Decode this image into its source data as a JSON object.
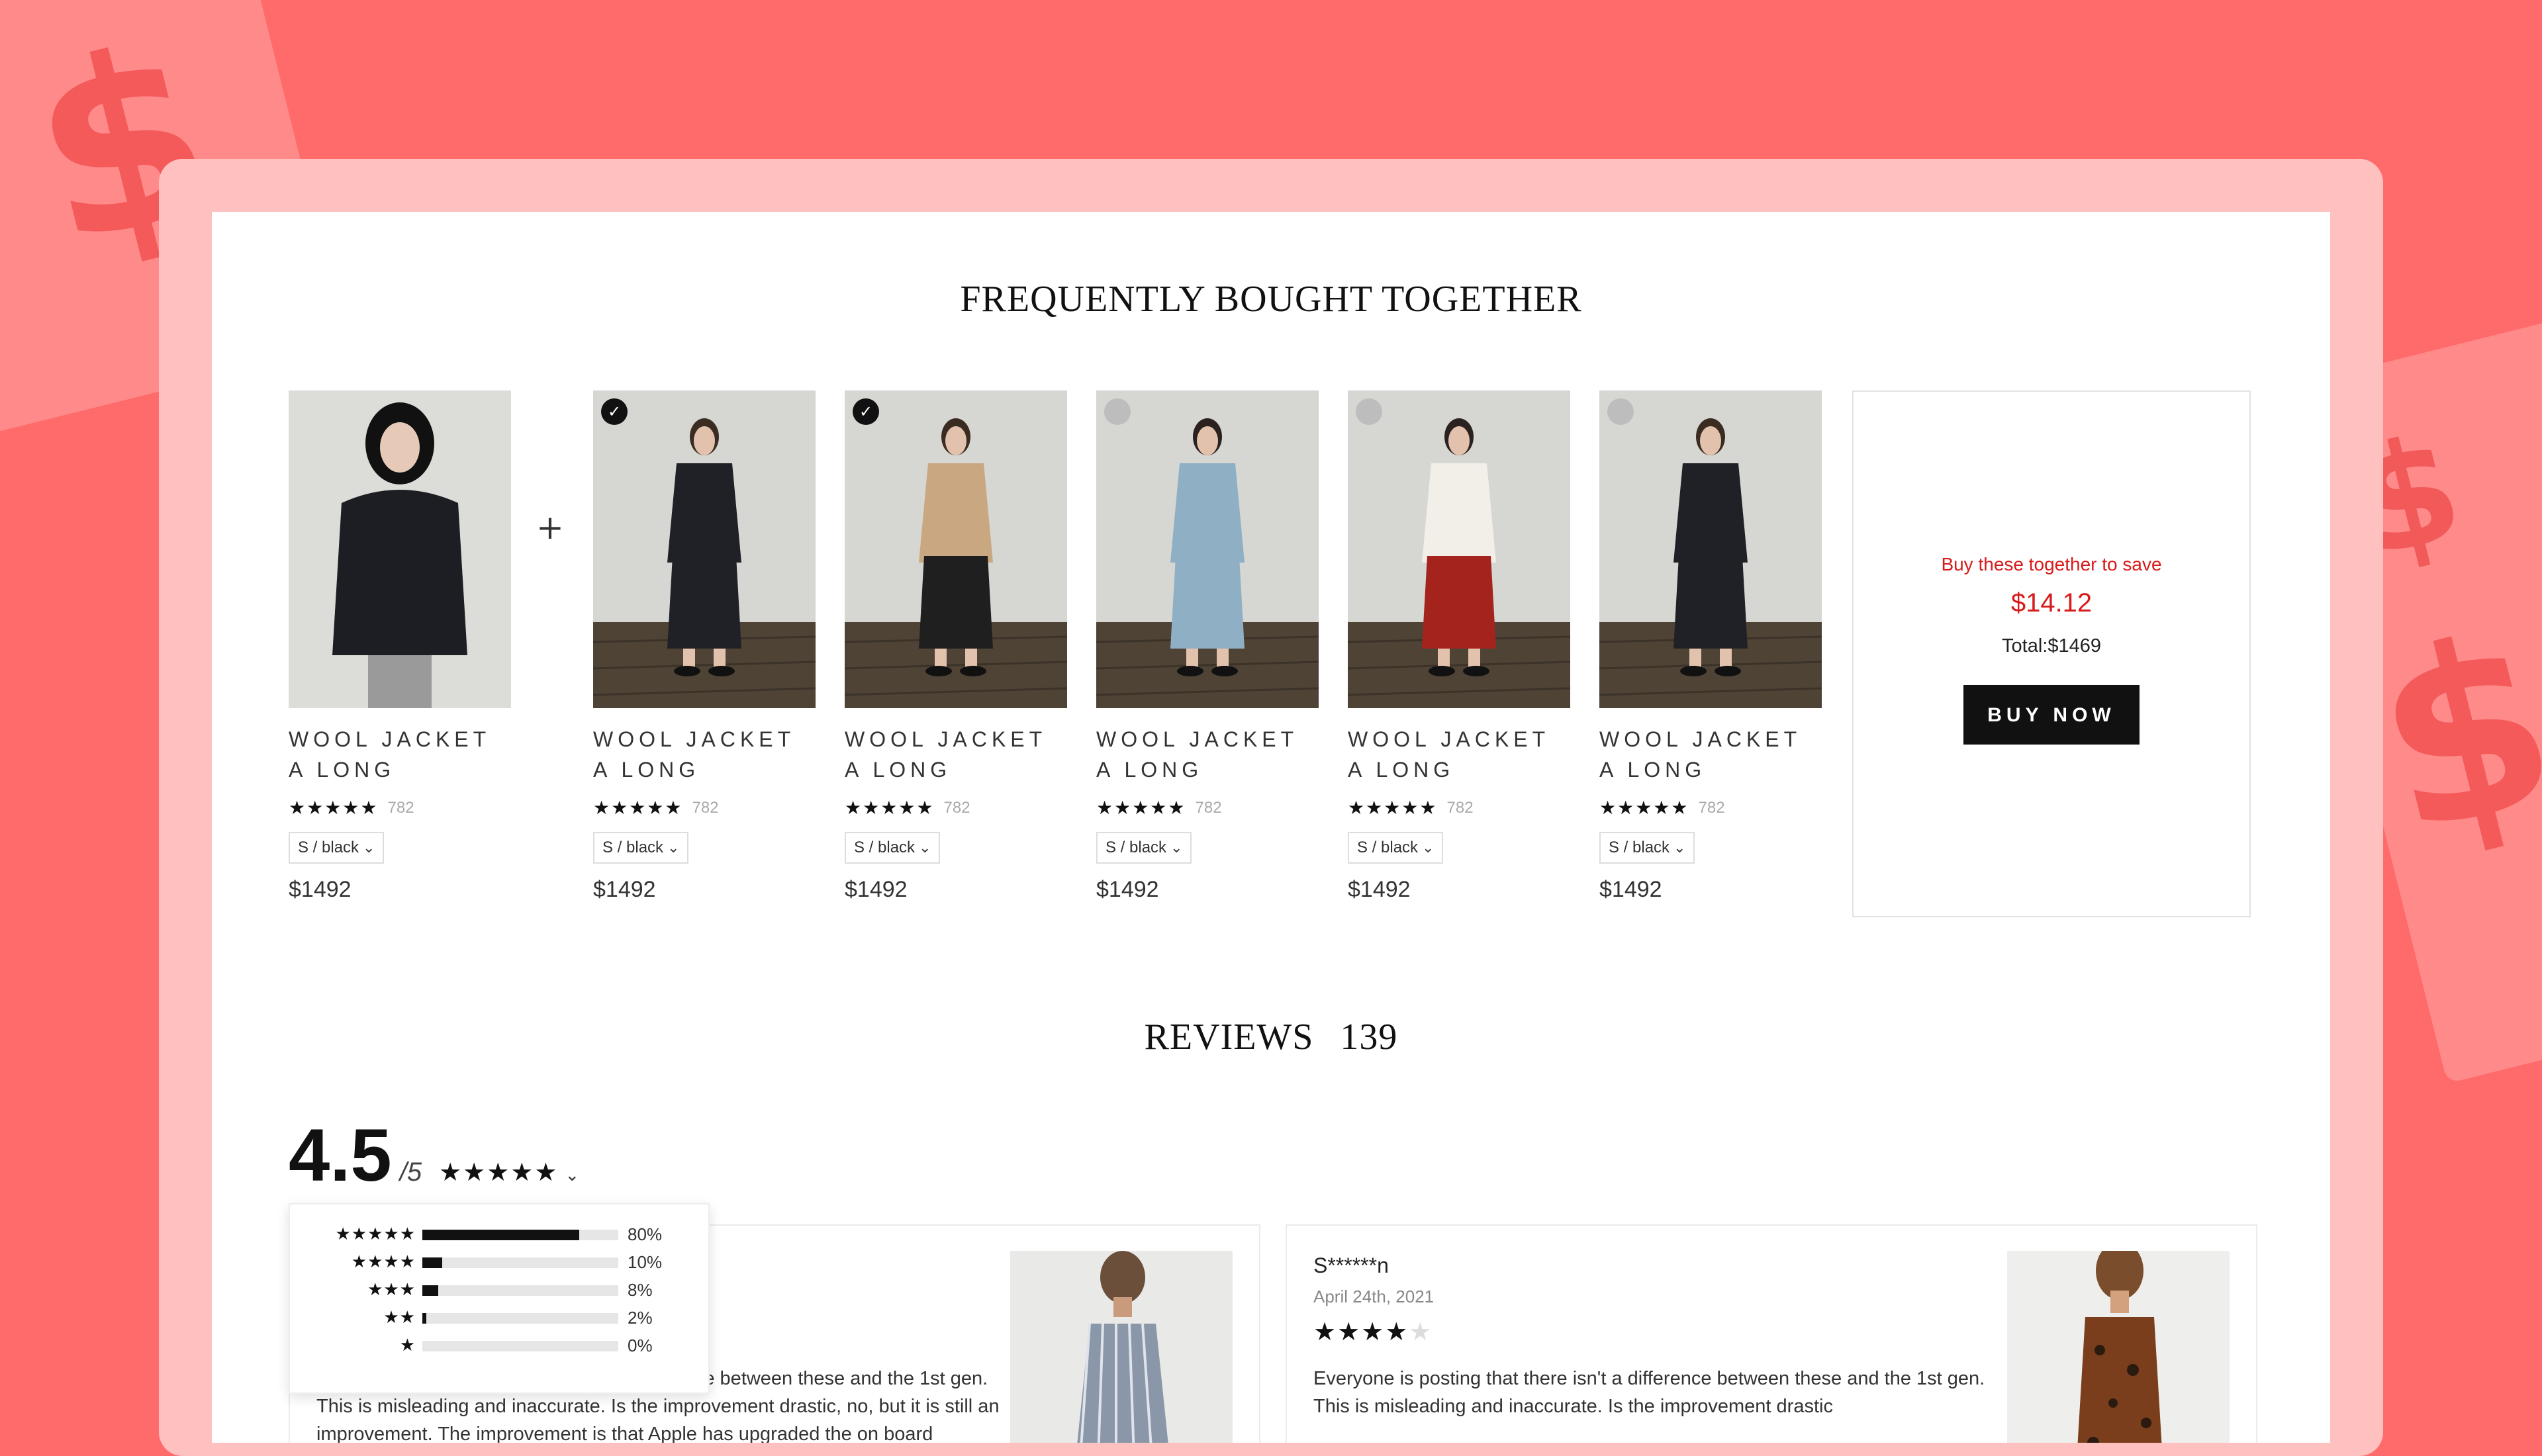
{
  "fbt": {
    "title": "FREQUENTLY BOUGHT TOGETHER",
    "plus_sign": "+",
    "products": [
      {
        "name": "WOOL JACKET A LONG",
        "rating_stars": "★★★★★",
        "count": "782",
        "variant": "S / black",
        "price": "$1492",
        "selected": null,
        "outfit": "jacket-dark"
      },
      {
        "name": "WOOL JACKET A LONG",
        "rating_stars": "★★★★★",
        "count": "782",
        "variant": "S / black",
        "price": "$1492",
        "selected": true,
        "outfit": "suit-dark"
      },
      {
        "name": "WOOL JACKET A LONG",
        "rating_stars": "★★★★★",
        "count": "782",
        "variant": "S / black",
        "price": "$1492",
        "selected": true,
        "outfit": "trench-beige"
      },
      {
        "name": "WOOL JACKET A LONG",
        "rating_stars": "★★★★★",
        "count": "782",
        "variant": "S / black",
        "price": "$1492",
        "selected": false,
        "outfit": "dress-blue"
      },
      {
        "name": "WOOL JACKET A LONG",
        "rating_stars": "★★★★★",
        "count": "782",
        "variant": "S / black",
        "price": "$1492",
        "selected": false,
        "outfit": "skirt-red"
      },
      {
        "name": "WOOL JACKET A LONG",
        "rating_stars": "★★★★★",
        "count": "782",
        "variant": "S / black",
        "price": "$1492",
        "selected": false,
        "outfit": "suit-dark"
      }
    ],
    "save_box": {
      "text": "Buy these together to save",
      "amount": "$14.12",
      "total": "Total:$1469",
      "button": "BUY NOW"
    }
  },
  "reviews": {
    "title": "REVIEWS",
    "count": "139",
    "score": "4.5",
    "out_of": "/5",
    "score_stars": "★★★★★",
    "distribution": [
      {
        "stars": "★★★★★",
        "percent": 80,
        "label": "80%"
      },
      {
        "stars": "★★★★",
        "percent": 10,
        "label": "10%"
      },
      {
        "stars": "★★★",
        "percent": 8,
        "label": "8%"
      },
      {
        "stars": "★★",
        "percent": 2,
        "label": "2%"
      },
      {
        "stars": "★",
        "percent": 0,
        "label": "0%"
      }
    ],
    "cards": [
      {
        "author": "",
        "date": "",
        "stars": "★★★★",
        "stars_dim": "★",
        "body": "Everyone is posting that there isn't a difference between these and the 1st gen. This is misleading and inaccurate. Is the improvement drastic, no, but it is still an improvement. The improvement is that Apple has upgraded the on board"
      },
      {
        "author": "S******n",
        "date": "April 24th, 2021",
        "stars": "★★★★",
        "stars_dim": "★",
        "body": "Everyone is posting that there isn't a difference between these and the 1st gen. This is misleading and inaccurate. Is the improvement drastic"
      }
    ]
  },
  "colors": {
    "background": "#ff6b6b",
    "frame": "#ffc0c0",
    "accent_red": "#d81b1b",
    "button": "#111111"
  },
  "icons": {
    "check": "check-icon",
    "chevron": "chevron-down-icon",
    "star": "star-icon",
    "plus": "plus-icon",
    "background_decor": "dollar-sign-icon"
  }
}
